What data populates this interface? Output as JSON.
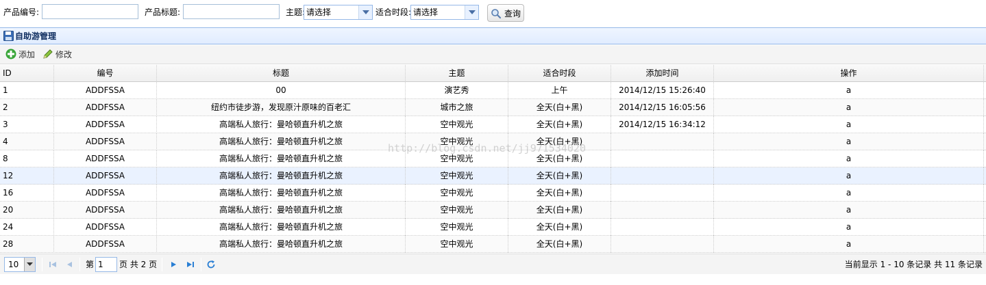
{
  "search": {
    "code_label": "产品编号:",
    "title_label": "产品标题:",
    "theme_label": "主题:",
    "theme_value": "请选择",
    "period_label": "适合时段:",
    "period_value": "请选择",
    "query_label": "查询"
  },
  "panel": {
    "title": "自助游管理"
  },
  "toolbar": {
    "add_label": "添加",
    "edit_label": "修改"
  },
  "grid": {
    "columns": [
      "ID",
      "编号",
      "标题",
      "主题",
      "适合时段",
      "添加时间",
      "操作"
    ],
    "rows": [
      [
        "1",
        "ADDFSSA",
        "00",
        "演艺秀",
        "上午",
        "2014/12/15 15:26:40",
        "a"
      ],
      [
        "2",
        "ADDFSSA",
        "纽约市徒步游，发现原汁原味的百老汇",
        "城市之旅",
        "全天(白+黑)",
        "2014/12/15 16:05:56",
        "a"
      ],
      [
        "3",
        "ADDFSSA",
        "高端私人旅行：曼哈顿直升机之旅",
        "空中观光",
        "全天(白+黑)",
        "2014/12/15 16:34:12",
        "a"
      ],
      [
        "4",
        "ADDFSSA",
        "高端私人旅行：曼哈顿直升机之旅",
        "空中观光",
        "全天(白+黑)",
        "",
        "a"
      ],
      [
        "8",
        "ADDFSSA",
        "高端私人旅行：曼哈顿直升机之旅",
        "空中观光",
        "全天(白+黑)",
        "",
        "a"
      ],
      [
        "12",
        "ADDFSSA",
        "高端私人旅行：曼哈顿直升机之旅",
        "空中观光",
        "全天(白+黑)",
        "",
        "a"
      ],
      [
        "16",
        "ADDFSSA",
        "高端私人旅行：曼哈顿直升机之旅",
        "空中观光",
        "全天(白+黑)",
        "",
        "a"
      ],
      [
        "20",
        "ADDFSSA",
        "高端私人旅行：曼哈顿直升机之旅",
        "空中观光",
        "全天(白+黑)",
        "",
        "a"
      ],
      [
        "24",
        "ADDFSSA",
        "高端私人旅行：曼哈顿直升机之旅",
        "空中观光",
        "全天(白+黑)",
        "",
        "a"
      ],
      [
        "28",
        "ADDFSSA",
        "高端私人旅行：曼哈顿直升机之旅",
        "空中观光",
        "全天(白+黑)",
        "",
        "a"
      ]
    ]
  },
  "watermark": "http://blog.csdn.net/jj971534020",
  "pager": {
    "page_size": "10",
    "page_prefix": "第",
    "page_value": "1",
    "page_suffix": "页 共 2 页",
    "info": "当前显示 1 - 10 条记录 共 11 条记录"
  },
  "colors": {
    "accent": "#95b8e7",
    "header_text": "#0e2d5f",
    "highlight_row": "#eaf2ff"
  }
}
